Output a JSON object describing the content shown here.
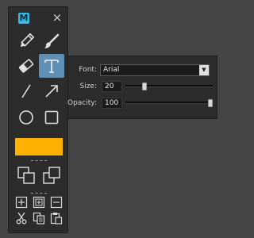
{
  "toolbar": {
    "app_icon_letter": "M",
    "close_glyph": "×",
    "active_tool": "text",
    "tools": [
      "pencil",
      "brush",
      "eraser",
      "text",
      "line",
      "arrow",
      "circle",
      "rectangle"
    ],
    "current_color": "#ffb000",
    "arrange_tools": [
      "bring-forward",
      "send-backward"
    ],
    "edit_tools": [
      "add-frame",
      "insert-frame",
      "remove-frame",
      "cut",
      "copy",
      "paste"
    ],
    "separator": "------"
  },
  "text_panel": {
    "font_label": "Font:",
    "font_value": "Arial",
    "size_label": "Size:",
    "size_value": "20",
    "size_level": 0.2,
    "opacity_label": "Opacity:",
    "opacity_value": "100",
    "opacity_level": 1.0
  },
  "colors": {
    "background": "#454545",
    "panel": "#2c2c2c",
    "active_tool": "#5f8fb5",
    "app_icon": "#3bb8e0",
    "swatch": "#ffb000"
  }
}
